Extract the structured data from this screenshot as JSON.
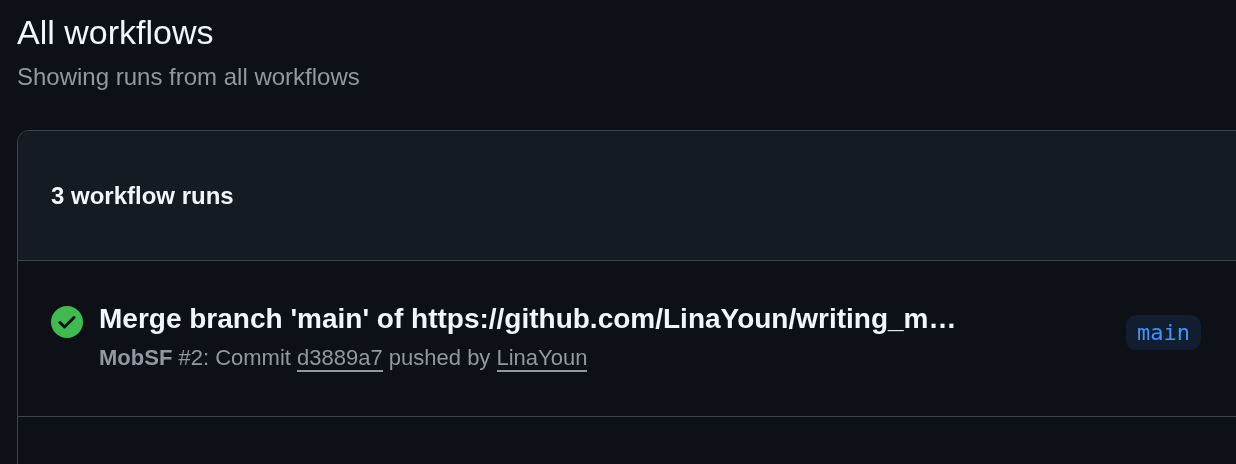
{
  "page": {
    "title": "All workflows",
    "subtitle": "Showing runs from all workflows"
  },
  "runs_box": {
    "count_label": "3 workflow runs",
    "runs": [
      {
        "succeeded": true,
        "title": "Merge branch 'main' of https://github.com/LinaYoun/writing_m…",
        "workflow": "MobSF",
        "run_text": "#2: Commit",
        "commit": "d3889a7",
        "pushed_text": "pushed by",
        "author": "LinaYoun",
        "branch": "main"
      }
    ]
  }
}
